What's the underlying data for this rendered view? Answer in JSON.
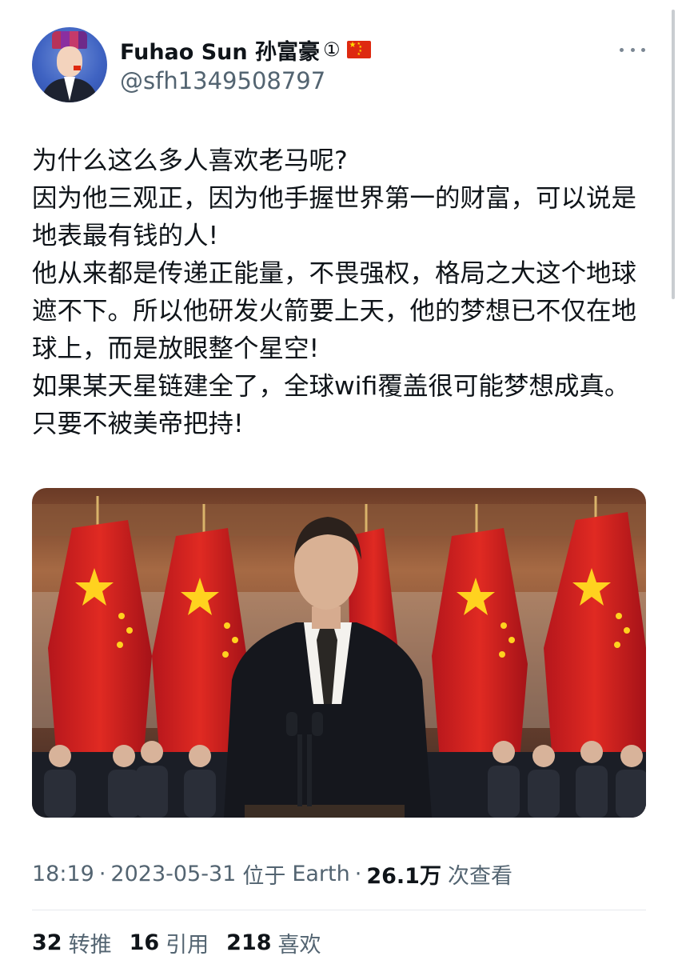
{
  "author": {
    "display_name": "Fuhao Sun 孙富豪",
    "badge": "①",
    "flag_icon": "china-flag-icon",
    "handle": "@sfh1349508797",
    "avatar_icon": "avatar-icon"
  },
  "more_icon": "more-options-icon",
  "tweet": {
    "paragraphs": [
      "为什么这么多人喜欢老马呢?",
      "因为他三观正，因为他手握世界第一的财富，可以说是地表最有钱的人!",
      "他从来都是传递正能量，不畏强权，格局之大这个地球遮不下。所以他研发火箭要上天，他的梦想已不仅在地球上，而是放眼整个星空!",
      "如果某天星链建全了，全球wifi覆盖很可能梦想成真。只要不被美帝把持!"
    ]
  },
  "meta": {
    "time": "18:19",
    "separator": "·",
    "date": "2023-05-31",
    "location_prefix": "位于",
    "location": "Earth",
    "views": "26.1万",
    "views_label": "次查看"
  },
  "stats": {
    "retweets": "32",
    "retweets_label": "转推",
    "quotes": "16",
    "quotes_label": "引用",
    "likes": "218",
    "likes_label": "喜欢"
  },
  "colors": {
    "text_primary": "#0f1419",
    "text_secondary": "#536471",
    "flag_red": "#de2910",
    "flag_yellow": "#ffde00",
    "divider": "#e6e9ec"
  }
}
